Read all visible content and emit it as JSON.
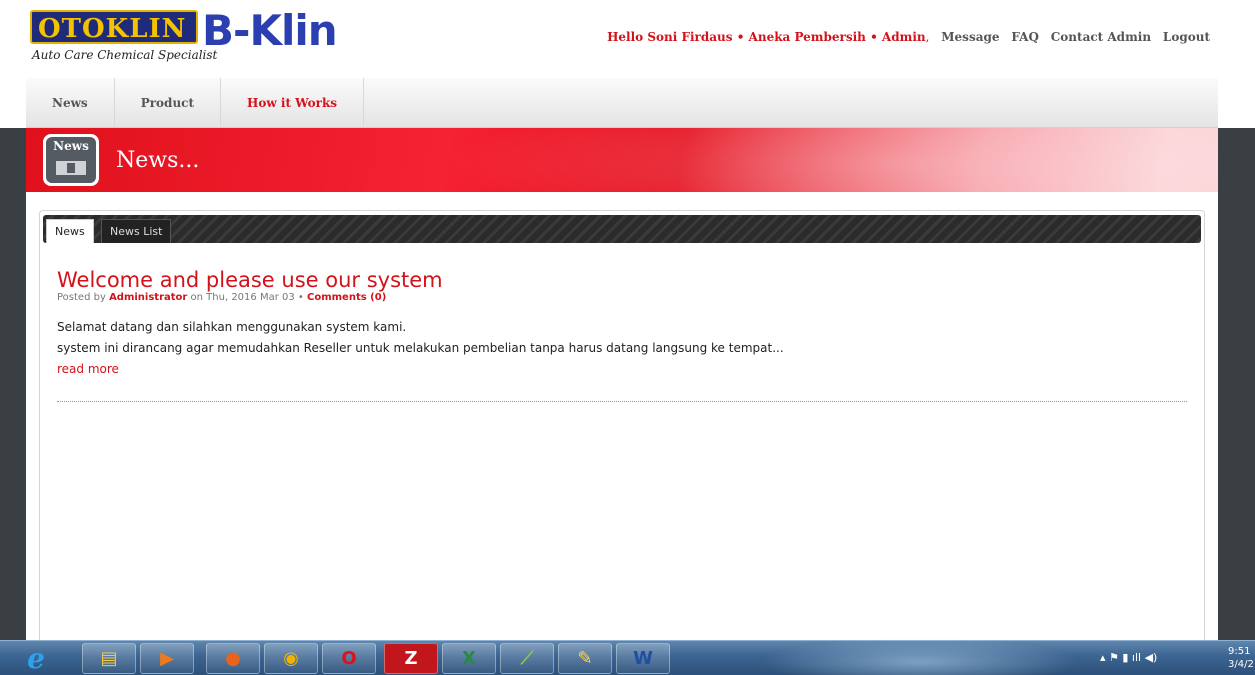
{
  "header": {
    "logo_primary": "OTOKLIN",
    "logo_tagline": "Auto Care Chemical Specialist",
    "logo_secondary": "B-Klin",
    "greeting": "Hello Soni Firdaus • Aneka Pembersih • Admin",
    "greeting_suffix": ",",
    "links": [
      "Message",
      "FAQ",
      "Contact Admin",
      "Logout"
    ]
  },
  "nav": {
    "items": [
      {
        "label": "News"
      },
      {
        "label": "Product"
      },
      {
        "label": "How it Works"
      }
    ]
  },
  "banner": {
    "icon_label": "News",
    "title": "News..."
  },
  "tabs": [
    {
      "label": "News"
    },
    {
      "label": "News List"
    }
  ],
  "article": {
    "title": "Welcome and please use our system",
    "posted_by_prefix": "Posted by",
    "author": "Administrator",
    "date_text": "on Thu, 2016 Mar 03 •",
    "comments": "Comments (0)",
    "line1": "Selamat datang dan silahkan menggunakan system kami.",
    "line2": "system ini dirancang agar memudahkan Reseller untuk melakukan pembelian tanpa harus datang langsung ke tempat...",
    "read_more": "read more"
  },
  "taskbar": {
    "apps": [
      "internet-explorer",
      "file-explorer",
      "media-player",
      "firefox",
      "chrome",
      "opera",
      "filezilla",
      "excel",
      "chart-app",
      "paint",
      "word"
    ],
    "clock_time": "9:51",
    "clock_date": "3/4/2"
  },
  "colors": {
    "accent": "#d3121a",
    "banner_red": "#e0101c",
    "taskbar": "#3c6491"
  }
}
